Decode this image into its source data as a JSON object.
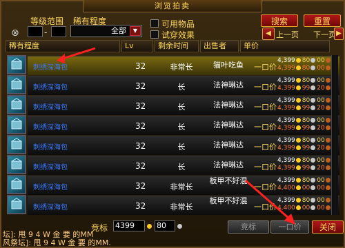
{
  "window": {
    "title": "浏览拍卖"
  },
  "filters": {
    "level_range_label": "等级范围",
    "rarity_label": "稀有程度",
    "rarity_value": "全部",
    "usable_label": "可用物品",
    "preview_label": "试穿效果"
  },
  "buttons": {
    "search": "搜索",
    "reset": "重置",
    "prev_page": "上一页",
    "next_page": "下一页",
    "bid": "竞标",
    "buyout": "一口价",
    "close": "关闭"
  },
  "columns": {
    "rarity": "稀有程度",
    "level": "Lv",
    "time_left": "剩余时间",
    "seller": "出售者",
    "unit_price": "单价"
  },
  "rows": [
    {
      "name": "刺绣深海包",
      "level": "32",
      "time": "非常长",
      "seller": "猫叶吃鱼",
      "buyout_label": "一口价",
      "p1": [
        "4,399",
        "80",
        "00"
      ],
      "p2": [
        "4,399",
        "80",
        "00"
      ],
      "selected": true
    },
    {
      "name": "刺绣深海包",
      "level": "32",
      "time": "长",
      "seller": "法神琳达",
      "buyout_label": "一口价",
      "p1": [
        "4,399",
        "80",
        "00"
      ],
      "p2": [
        "4,399",
        "99",
        "20"
      ]
    },
    {
      "name": "刺绣深海包",
      "level": "32",
      "time": "长",
      "seller": "法神琳达",
      "buyout_label": "一口价",
      "p1": [
        "4,399",
        "80",
        "00"
      ],
      "p2": [
        "4,399",
        "99",
        "20"
      ]
    },
    {
      "name": "刺绣深海包",
      "level": "32",
      "time": "长",
      "seller": "法神琳达",
      "buyout_label": "一口价",
      "p1": [
        "4,399",
        "80",
        "00"
      ],
      "p2": [
        "4,399",
        "99",
        "20"
      ]
    },
    {
      "name": "刺绣深海包",
      "level": "32",
      "time": "长",
      "seller": "法神琳达",
      "buyout_label": "一口价",
      "p1": [
        "4,399",
        "80",
        "00"
      ],
      "p2": [
        "4,399",
        "99",
        "20"
      ]
    },
    {
      "name": "刺绣深海包",
      "level": "32",
      "time": "长",
      "seller": "法神琳达",
      "buyout_label": "一口价",
      "p1": [
        "4,399",
        "80",
        "00"
      ],
      "p2": [
        "4,399",
        "99",
        "20"
      ]
    },
    {
      "name": "刺绣深海包",
      "level": "32",
      "time": "非常长",
      "seller": "板甲不好混",
      "buyout_label": "一口价",
      "p1": [
        "4,399",
        "80",
        "00"
      ],
      "p2": [
        "4,400",
        "00",
        "00"
      ]
    },
    {
      "name": "刺绣深海包",
      "level": "32",
      "time": "非常长",
      "seller": "板甲不好混",
      "buyout_label": "一口价",
      "p1": [
        "4,399",
        "80",
        "00"
      ],
      "p2": [
        "4,400",
        "00",
        "00"
      ]
    }
  ],
  "bid": {
    "label": "竞标",
    "gold": "4399",
    "silver": "80"
  },
  "chat": {
    "line1": "坛]: 甩 9 4 W 金 要 的MM",
    "line2": "风祭坛]: 甩 9 4 W 金 要 的MM."
  },
  "colors": {
    "gold": "#ffcc22",
    "silver": "#c8c8c8",
    "copper": "#c06020",
    "accent_red": "#b01818"
  }
}
